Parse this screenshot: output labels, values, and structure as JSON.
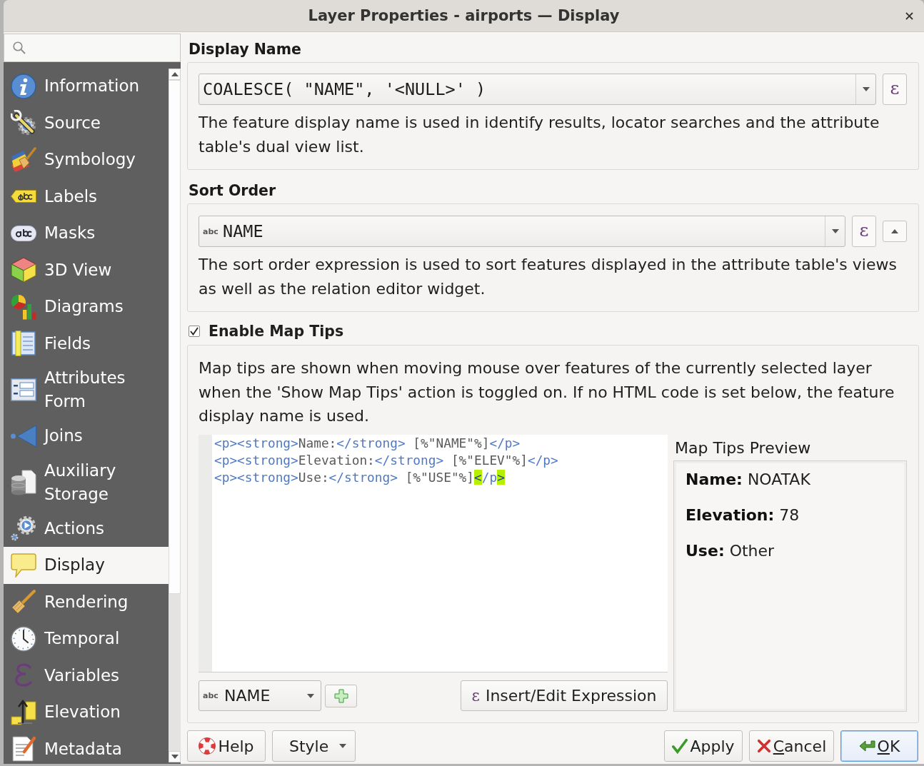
{
  "window": {
    "title": "Layer Properties - airports — Display"
  },
  "sidebar": {
    "items": [
      {
        "label": "Information",
        "selected": false
      },
      {
        "label": "Source",
        "selected": false
      },
      {
        "label": "Symbology",
        "selected": false
      },
      {
        "label": "Labels",
        "selected": false
      },
      {
        "label": "Masks",
        "selected": false
      },
      {
        "label": "3D View",
        "selected": false
      },
      {
        "label": "Diagrams",
        "selected": false
      },
      {
        "label": "Fields",
        "selected": false
      },
      {
        "label": "Attributes Form",
        "selected": false
      },
      {
        "label": "Joins",
        "selected": false
      },
      {
        "label": "Auxiliary Storage",
        "selected": false
      },
      {
        "label": "Actions",
        "selected": false
      },
      {
        "label": "Display",
        "selected": true
      },
      {
        "label": "Rendering",
        "selected": false
      },
      {
        "label": "Temporal",
        "selected": false
      },
      {
        "label": "Variables",
        "selected": false
      },
      {
        "label": "Elevation",
        "selected": false
      },
      {
        "label": "Metadata",
        "selected": false
      }
    ]
  },
  "display_name": {
    "heading": "Display Name",
    "expression": "COALESCE( \"NAME\", '<NULL>' )",
    "expression_button": "ε",
    "description": "The feature display name is used in identify results, locator searches and the attribute table's dual view list."
  },
  "sort_order": {
    "heading": "Sort Order",
    "field_type": "abc",
    "field": "NAME",
    "expression_button": "ε",
    "ascending": true,
    "description": "The sort order expression is used to sort features displayed in the attribute table's views as well as the relation editor widget."
  },
  "map_tips": {
    "label": "Enable Map Tips",
    "checked": true,
    "description": "Map tips are shown when moving mouse over features of the currently selected layer when the 'Show Map Tips' action is toggled on. If no HTML code is set below, the feature display name is used.",
    "html_lines": [
      [
        {
          "kind": "tag",
          "text": "<p><strong>"
        },
        {
          "kind": "text",
          "text": "Name:"
        },
        {
          "kind": "tag",
          "text": "</strong>"
        },
        {
          "kind": "text",
          "text": " [%\"NAME\"%]"
        },
        {
          "kind": "tag",
          "text": "</p>"
        }
      ],
      [
        {
          "kind": "tag",
          "text": "<p><strong>"
        },
        {
          "kind": "text",
          "text": "Elevation:"
        },
        {
          "kind": "tag",
          "text": "</strong>"
        },
        {
          "kind": "text",
          "text": " [%\"ELEV\"%]"
        },
        {
          "kind": "tag",
          "text": "</p>"
        }
      ],
      [
        {
          "kind": "tag",
          "text": "<p><strong>"
        },
        {
          "kind": "text",
          "text": "Use:"
        },
        {
          "kind": "tag",
          "text": "</strong>"
        },
        {
          "kind": "text",
          "text": " [%\"USE\"%]"
        },
        {
          "kind": "match",
          "text": "<"
        },
        {
          "kind": "tag",
          "text": "/p"
        },
        {
          "kind": "match",
          "text": ">"
        }
      ]
    ],
    "field_type": "abc",
    "field": "NAME",
    "insert_button": {
      "glyph": "ε",
      "label": "Insert/Edit Expression"
    },
    "preview": {
      "title": "Map Tips Preview",
      "lines": [
        "**Name:** NOATAK",
        "**Elevation:** 78",
        "**Use:** Other"
      ]
    }
  },
  "buttons": {
    "left": [
      {
        "kind": "help",
        "label": "Help",
        "underline_first": false,
        "focused": false
      },
      {
        "kind": "menu",
        "label": "Style",
        "underline_first": false,
        "focused": false
      }
    ],
    "right": [
      {
        "kind": "apply",
        "label": "Apply",
        "underline_first": false,
        "focused": false
      },
      {
        "kind": "cancel",
        "label": "Cancel",
        "underline_first": true,
        "focused": false
      },
      {
        "kind": "ok",
        "label": "OK",
        "underline_first": true,
        "focused": true
      }
    ]
  }
}
